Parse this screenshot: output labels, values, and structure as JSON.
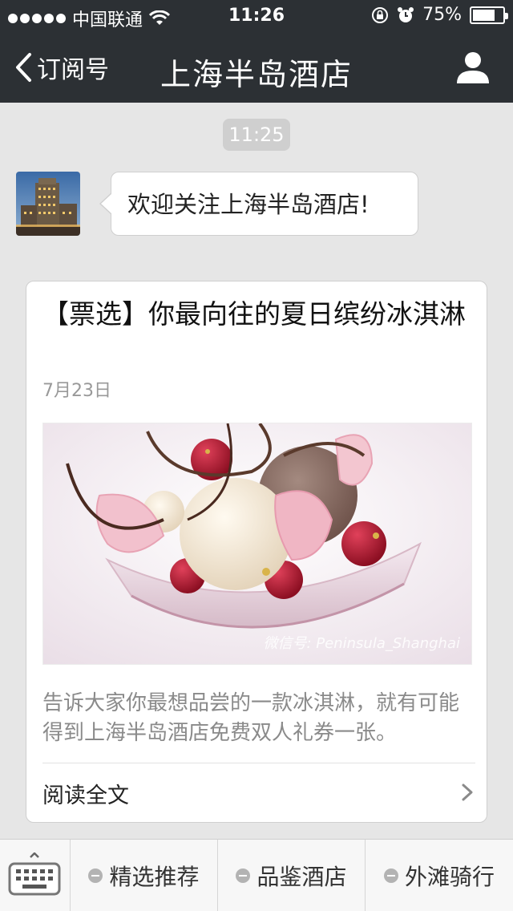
{
  "status_bar": {
    "carrier": "中国联通",
    "time": "11:26",
    "battery_text": "75%",
    "battery_level": 0.75
  },
  "nav": {
    "back_label": "订阅号",
    "title": "上海半岛酒店"
  },
  "chat": {
    "time_chip": "11:25",
    "welcome_message": "欢迎关注上海半岛酒店!"
  },
  "article": {
    "title": "【票选】你最向往的夏日缤纷冰淇淋",
    "date": "7月23日",
    "image_watermark": "微信号: Peninsula_Shanghai",
    "description": "告诉大家你最想品尝的一款冰淇淋，就有可能得到上海半岛酒店免费双人礼券一张。",
    "read_more": "阅读全文"
  },
  "menu": {
    "items": [
      {
        "label": "精选推荐"
      },
      {
        "label": "品鉴酒店"
      },
      {
        "label": "外滩骑行"
      }
    ]
  },
  "colors": {
    "header": "#2c3034",
    "background": "#e6e6e6",
    "card": "#ffffff"
  }
}
